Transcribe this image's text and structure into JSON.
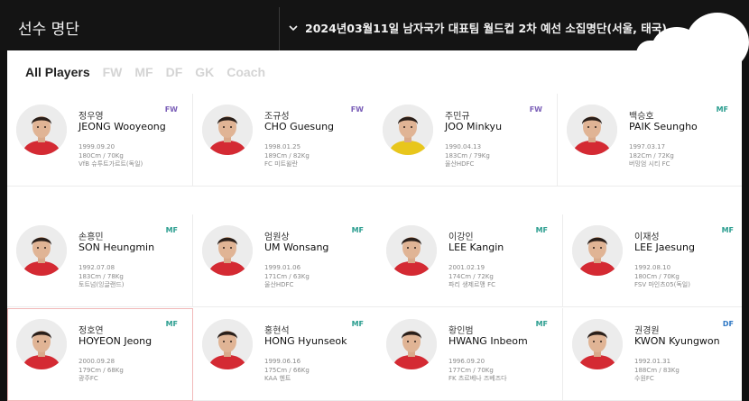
{
  "header": {
    "title": "선수 명단",
    "dropdown_label": "2024년03월11일 남자국가 대표팀 월드컵 2차 예선 소집명단(서울, 태국)"
  },
  "tabs": [
    {
      "label": "All Players",
      "active": true
    },
    {
      "label": "FW",
      "active": false
    },
    {
      "label": "MF",
      "active": false
    },
    {
      "label": "DF",
      "active": false
    },
    {
      "label": "GK",
      "active": false
    },
    {
      "label": "Coach",
      "active": false
    }
  ],
  "colors": {
    "FW": "#7b5fb8",
    "MF": "#2a9d8f",
    "DF": "#2f78c4",
    "jersey_red": "#d42a33",
    "jersey_gk": "#e8c61c"
  },
  "players": [
    {
      "name_ko": "정우영",
      "name_en": "JEONG Wooyeong",
      "pos": "FW",
      "birth": "1999.09.20",
      "body": "180Cm / 70Kg",
      "club": "VfB 슈투트가르트(독일)",
      "jersey": "red",
      "icon": "player-photo-icon"
    },
    {
      "name_ko": "조규성",
      "name_en": "CHO Guesung",
      "pos": "FW",
      "birth": "1998.01.25",
      "body": "189Cm / 82Kg",
      "club": "FC 미트윌란",
      "jersey": "red",
      "icon": "player-photo-icon"
    },
    {
      "name_ko": "주민규",
      "name_en": "JOO Minkyu",
      "pos": "FW",
      "birth": "1990.04.13",
      "body": "183Cm / 79Kg",
      "club": "울산HDFC",
      "jersey": "yellow",
      "icon": "player-photo-icon"
    },
    {
      "name_ko": "백승호",
      "name_en": "PAIK Seungho",
      "pos": "MF",
      "birth": "1997.03.17",
      "body": "182Cm / 72Kg",
      "club": "버밍엄 시티 FC",
      "jersey": "red",
      "icon": "player-photo-icon"
    },
    {
      "name_ko": "손흥민",
      "name_en": "SON Heungmin",
      "pos": "MF",
      "birth": "1992.07.08",
      "body": "183Cm / 78Kg",
      "club": "토트넘(잉글랜드)",
      "jersey": "red",
      "icon": "player-photo-icon"
    },
    {
      "name_ko": "엄원상",
      "name_en": "UM Wonsang",
      "pos": "MF",
      "birth": "1999.01.06",
      "body": "171Cm / 63Kg",
      "club": "울산HDFC",
      "jersey": "red",
      "icon": "player-photo-icon"
    },
    {
      "name_ko": "이강인",
      "name_en": "LEE Kangin",
      "pos": "MF",
      "birth": "2001.02.19",
      "body": "174Cm / 72Kg",
      "club": "파리 생제르맹 FC",
      "jersey": "red",
      "icon": "player-photo-icon"
    },
    {
      "name_ko": "이재성",
      "name_en": "LEE Jaesung",
      "pos": "MF",
      "birth": "1992.08.10",
      "body": "180Cm / 70Kg",
      "club": "FSV 마인츠05(독일)",
      "jersey": "red",
      "icon": "player-photo-icon"
    },
    {
      "name_ko": "정호연",
      "name_en": "HOYEON Jeong",
      "pos": "MF",
      "birth": "2000.09.28",
      "body": "179Cm / 68Kg",
      "club": "광주FC",
      "jersey": "red",
      "icon": "player-photo-icon"
    },
    {
      "name_ko": "홍현석",
      "name_en": "HONG Hyunseok",
      "pos": "MF",
      "birth": "1999.06.16",
      "body": "175Cm / 66Kg",
      "club": "KAA 헨트",
      "jersey": "red",
      "icon": "player-photo-icon"
    },
    {
      "name_ko": "황인범",
      "name_en": "HWANG Inbeom",
      "pos": "MF",
      "birth": "1996.09.20",
      "body": "177Cm / 70Kg",
      "club": "FK 츠르베나 즈베즈다",
      "jersey": "red",
      "icon": "player-photo-icon"
    },
    {
      "name_ko": "권경원",
      "name_en": "KWON Kyungwon",
      "pos": "DF",
      "birth": "1992.01.31",
      "body": "188Cm / 83Kg",
      "club": "수원FC",
      "jersey": "red",
      "icon": "player-photo-icon"
    }
  ],
  "icons": {
    "dropdown": "chevron-down-icon"
  }
}
